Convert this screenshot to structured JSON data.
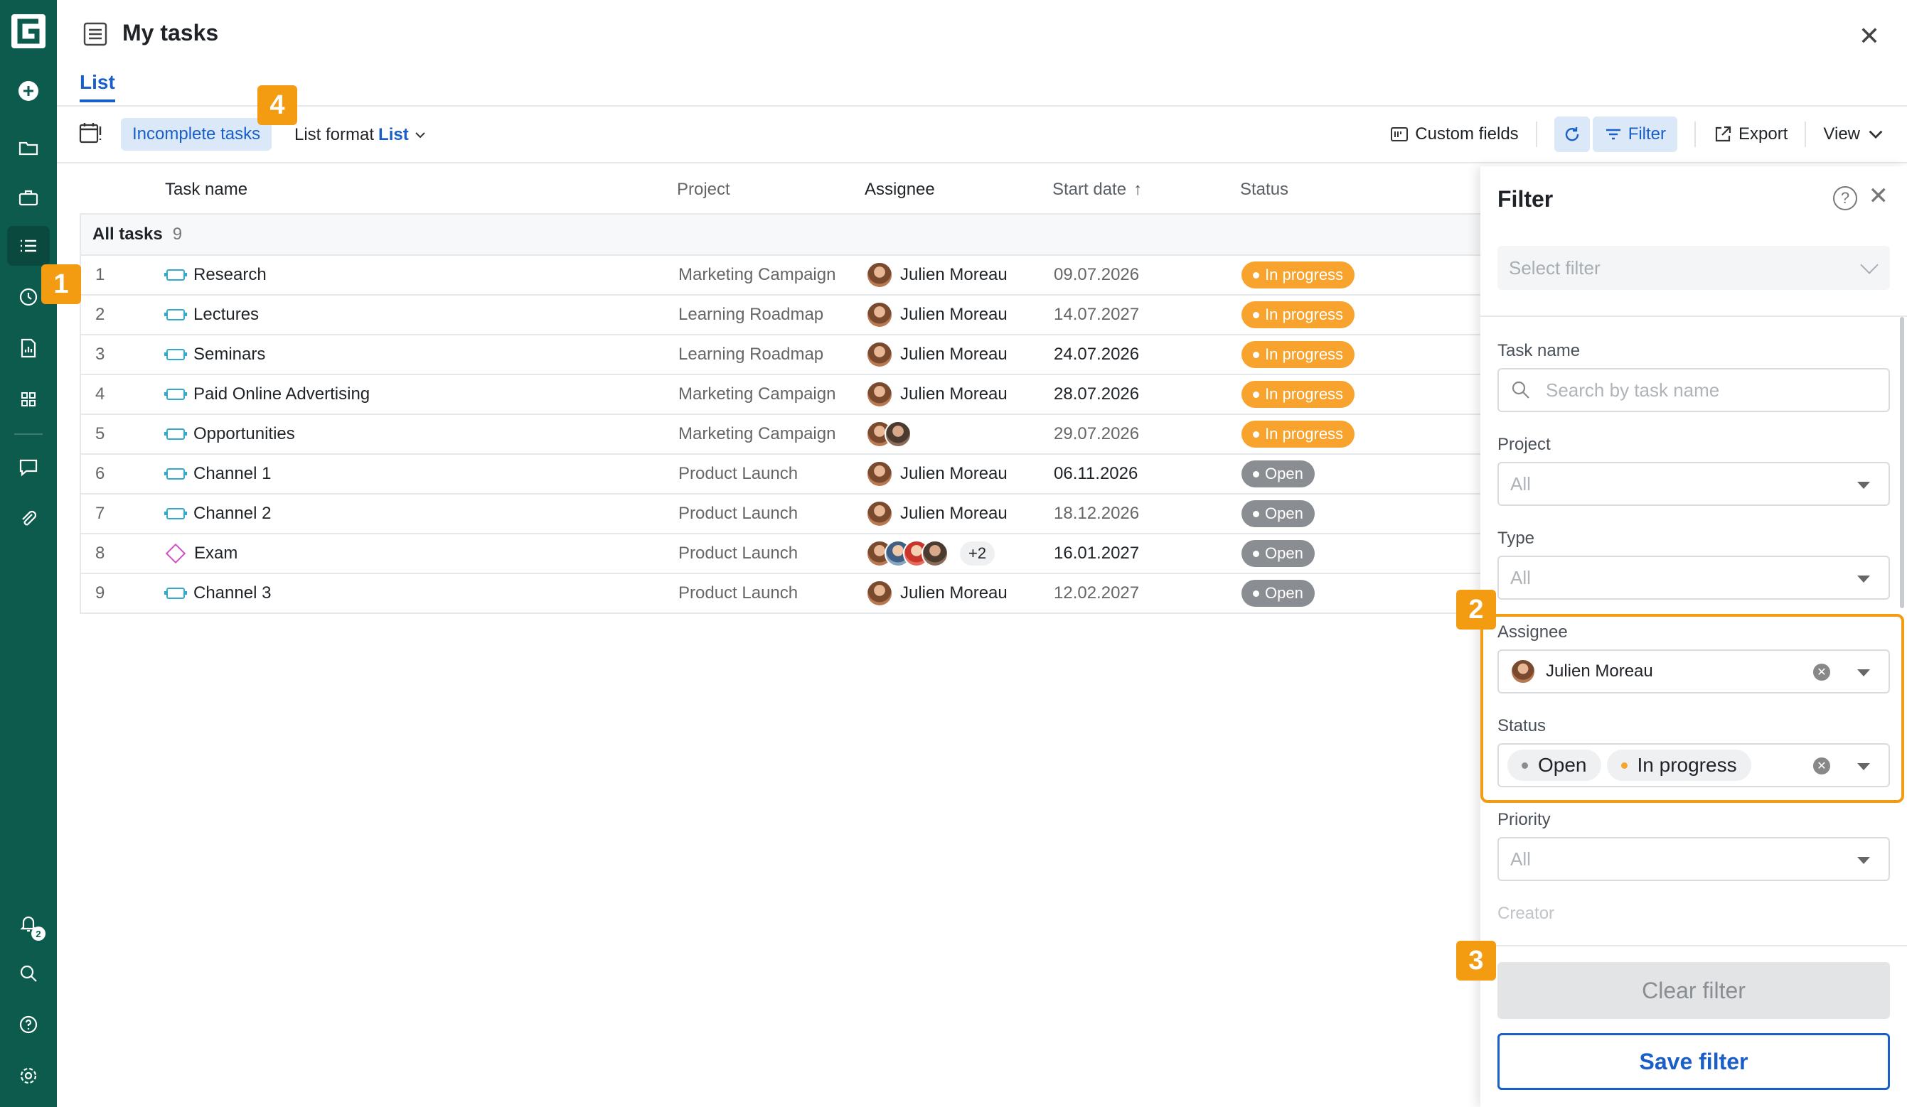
{
  "header": {
    "title": "My tasks",
    "tab": "List"
  },
  "toolbar": {
    "incomplete_label": "Incomplete tasks",
    "list_format_label": "List format",
    "list_format_value": "List",
    "custom_fields": "Custom fields",
    "filter": "Filter",
    "export": "Export",
    "view": "View"
  },
  "table": {
    "columns": {
      "task_name": "Task name",
      "project": "Project",
      "assignee": "Assignee",
      "start_date": "Start date",
      "status": "Status"
    },
    "group": {
      "label": "All tasks",
      "count": "9"
    },
    "rows": [
      {
        "num": "1",
        "name": "Research",
        "project": "Marketing Campaign",
        "assignee": "Julien Moreau",
        "date": "09.07.2026",
        "status": "In progress"
      },
      {
        "num": "2",
        "name": "Lectures",
        "project": "Learning Roadmap",
        "assignee": "Julien Moreau",
        "date": "14.07.2027",
        "status": "In progress"
      },
      {
        "num": "3",
        "name": "Seminars",
        "project": "Learning Roadmap",
        "assignee": "Julien Moreau",
        "date": "24.07.2026",
        "status": "In progress"
      },
      {
        "num": "4",
        "name": "Paid Online Advertising",
        "project": "Marketing Campaign",
        "assignee": "Julien Moreau",
        "date": "28.07.2026",
        "status": "In progress"
      },
      {
        "num": "5",
        "name": "Opportunities",
        "project": "Marketing Campaign",
        "assignee": "",
        "date": "29.07.2026",
        "status": "In progress"
      },
      {
        "num": "6",
        "name": "Channel 1",
        "project": "Product Launch",
        "assignee": "Julien Moreau",
        "date": "06.11.2026",
        "status": "Open"
      },
      {
        "num": "7",
        "name": "Channel 2",
        "project": "Product Launch",
        "assignee": "Julien Moreau",
        "date": "18.12.2026",
        "status": "Open"
      },
      {
        "num": "8",
        "name": "Exam",
        "project": "Product Launch",
        "assignee": "+2",
        "date": "16.01.2027",
        "status": "Open"
      },
      {
        "num": "9",
        "name": "Channel 3",
        "project": "Product Launch",
        "assignee": "Julien Moreau",
        "date": "12.02.2027",
        "status": "Open"
      }
    ]
  },
  "filter_panel": {
    "title": "Filter",
    "select_filter": "Select filter",
    "task_name_label": "Task name",
    "task_name_placeholder": "Search by task name",
    "project_label": "Project",
    "project_value": "All",
    "type_label": "Type",
    "type_value": "All",
    "assignee_label": "Assignee",
    "assignee_value": "Julien Moreau",
    "status_label": "Status",
    "status_chips": [
      "Open",
      "In progress"
    ],
    "priority_label": "Priority",
    "priority_value": "All",
    "creator_label": "Creator",
    "clear_filter": "Clear filter",
    "save_filter": "Save filter"
  },
  "callouts": [
    "1",
    "2",
    "3",
    "4"
  ],
  "sidebar": {
    "notification_count": "2"
  },
  "colors": {
    "sidebar": "#0c5b4c",
    "accent": "#1a5fc7",
    "in_progress": "#f7a32e",
    "open": "#8a8d91",
    "callout": "#f39c12"
  }
}
